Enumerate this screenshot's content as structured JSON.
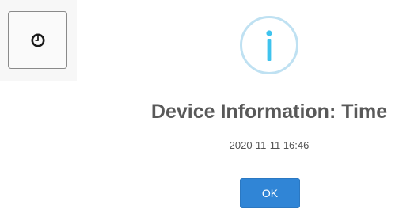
{
  "toolbar": {
    "clock_button_icon": "clock-icon"
  },
  "dialog": {
    "icon": "info-icon",
    "icon_color": "#bfe1f2",
    "icon_glyph_color": "#3fc3ee",
    "title": "Device Information: Time",
    "text": "2020-11-11 16:46",
    "confirm_label": "OK",
    "confirm_color": "#3085d6"
  }
}
